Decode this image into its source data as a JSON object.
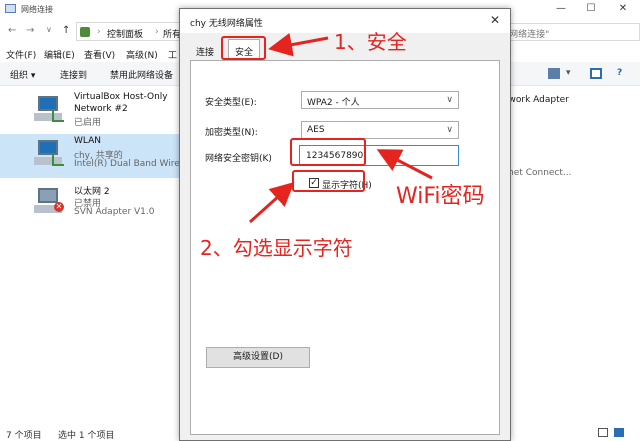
{
  "window": {
    "title": "网络连接",
    "controls": [
      "—",
      "☐",
      "✕"
    ]
  },
  "address": {
    "breadcrumbs": [
      "控制面板",
      "所有"
    ],
    "search_placeholder": "\"网络连接\""
  },
  "menubar": [
    "文件(F)",
    "编辑(E)",
    "查看(V)",
    "高级(N)",
    "工"
  ],
  "toolbar": [
    "组织 ▾",
    "连接到",
    "禁用此网络设备"
  ],
  "adapters": [
    {
      "name": "VirtualBox Host-Only",
      "name2": "Network #2",
      "status": "已启用",
      "device": ""
    },
    {
      "name": "WLAN",
      "name2": "",
      "status": "chy, 共享的",
      "device": "Intel(R) Dual Band Wirel"
    },
    {
      "name": "以太网 2",
      "name2": "",
      "status": "已禁用",
      "device": "SVN Adapter V1.0"
    }
  ],
  "right_column": [
    "twork Adapter",
    "met Connect..."
  ],
  "status_bar": {
    "count": "7 个项目",
    "selected": "选中 1 个项目"
  },
  "dialog": {
    "title": "chy 无线网络属性",
    "close": "✕",
    "tabs": [
      "连接",
      "安全"
    ],
    "fields": {
      "security_type_label": "安全类型(E):",
      "security_type_value": "WPA2 - 个人",
      "encryption_label": "加密类型(N):",
      "encryption_value": "AES",
      "key_label": "网络安全密钥(K)",
      "key_value": "1234567890",
      "show_chars_label": "显示字符(H)"
    },
    "advanced_button": "高级设置(D)"
  },
  "annotations": {
    "step1": "1、安全",
    "wifi": "WiFi密码",
    "step2": "2、勾选显示字符"
  },
  "colors": {
    "annotation": "#e52420",
    "selection": "#cce4f7"
  }
}
